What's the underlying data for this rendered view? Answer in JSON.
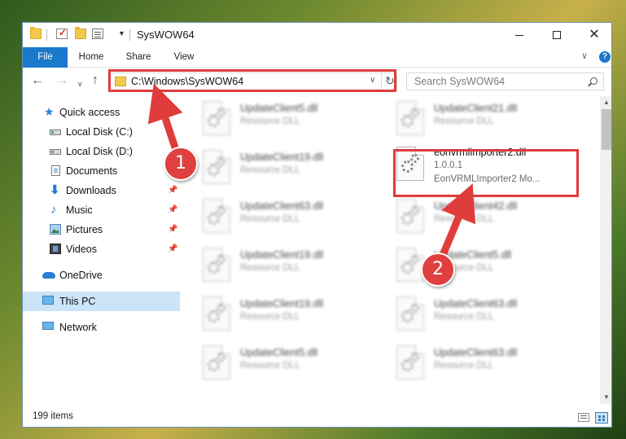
{
  "window": {
    "title": "SysWOW64"
  },
  "ribbon": {
    "tabs": [
      "File",
      "Home",
      "Share",
      "View"
    ]
  },
  "nav": {
    "address": "C:\\Windows\\SysWOW64",
    "search_placeholder": "Search SysWOW64"
  },
  "sidebar": {
    "items": [
      {
        "label": "Quick access",
        "icon": "star-icon"
      },
      {
        "label": "Local Disk (C:)",
        "icon": "drive-icon"
      },
      {
        "label": "Local Disk (D:)",
        "icon": "drive-icon"
      },
      {
        "label": "Documents",
        "icon": "documents-icon",
        "pinned": true
      },
      {
        "label": "Downloads",
        "icon": "downloads-icon",
        "pinned": true
      },
      {
        "label": "Music",
        "icon": "music-icon",
        "pinned": true
      },
      {
        "label": "Pictures",
        "icon": "pictures-icon",
        "pinned": true
      },
      {
        "label": "Videos",
        "icon": "videos-icon",
        "pinned": true
      },
      {
        "label": "OneDrive",
        "icon": "onedrive-icon"
      },
      {
        "label": "This PC",
        "icon": "this-pc-icon",
        "selected": true
      },
      {
        "label": "Network",
        "icon": "network-icon"
      }
    ]
  },
  "files": {
    "left_column": [
      {
        "name": "UpdateClient5.dll",
        "type": "Resource DLL"
      },
      {
        "name": "UpdateClient19.dll",
        "type": "Resource DLL"
      },
      {
        "name": "UpdateClient63.dll",
        "type": "Resource DLL"
      },
      {
        "name": "UpdateClient19.dll",
        "type": "Resource DLL"
      },
      {
        "name": "UpdateClient19.dll",
        "type": "Resource DLL"
      },
      {
        "name": "UpdateClient5.dll",
        "type": "Resource DLL"
      }
    ],
    "right_column": [
      {
        "name": "UpdateClient21.dll",
        "type": "Resource DLL"
      },
      {
        "name": "eonvrmlimporter2.dll",
        "version": "1.0.0.1",
        "description": "EonVRMLImporter2 Mo...",
        "highlighted": true
      },
      {
        "name": "UpdateClient42.dll",
        "type": "Resource DLL"
      },
      {
        "name": "UpdateClient5.dll",
        "type": "Resource DLL"
      },
      {
        "name": "UpdateClient63.dll",
        "type": "Resource DLL"
      },
      {
        "name": "UpdateClient63.dll",
        "type": "Resource DLL"
      }
    ]
  },
  "status": {
    "item_count": "199 items"
  },
  "annotations": {
    "callout_1": "1",
    "callout_2": "2",
    "color": "#e03c3c"
  }
}
